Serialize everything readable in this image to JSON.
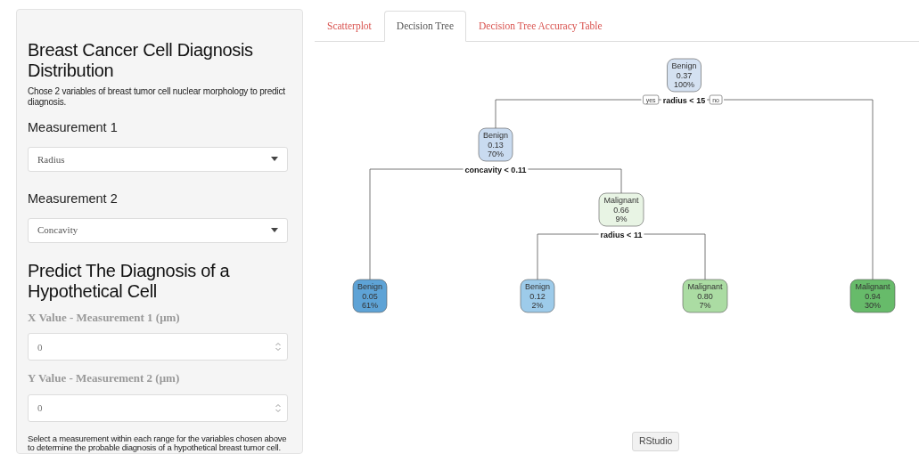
{
  "sidebar": {
    "title": "Breast Cancer Cell Diagnosis Distribution",
    "description": "Chose 2 variables of breast tumor cell nuclear morphology to predict diagnosis.",
    "selects": [
      {
        "label": "Measurement 1",
        "value": "Radius"
      },
      {
        "label": "Measurement 2",
        "value": "Concavity"
      }
    ],
    "predict_title": "Predict The Diagnosis of a Hypothetical Cell",
    "inputs": [
      {
        "label": "X Value - Measurement 1 (μm)",
        "value": "0"
      },
      {
        "label": "Y Value - Measurement 2 (μm)",
        "value": "0"
      }
    ],
    "note": "Select a measurement within each range for the variables chosen above to determine the probable diagnosis of a hypothetical breast tumor cell."
  },
  "tabs": [
    {
      "label": "Scatterplot",
      "selected": false
    },
    {
      "label": "Decision Tree",
      "selected": true
    },
    {
      "label": "Decision Tree Accuracy Table",
      "selected": false
    }
  ],
  "tree": {
    "label": "Benign",
    "prob": "0.37",
    "pct": "100%",
    "color": "#d4e1f1",
    "split": "radius < 15",
    "yes_label": "yes",
    "no_label": "no",
    "children": [
      {
        "label": "Benign",
        "prob": "0.13",
        "pct": "70%",
        "color": "#c9dbf0",
        "split": "concavity < 0.11",
        "children": [
          {
            "label": "Benign",
            "prob": "0.05",
            "pct": "61%",
            "color": "#5ea3d6"
          },
          {
            "label": "Malignant",
            "prob": "0.66",
            "pct": "9%",
            "color": "#e8f4e4",
            "split": "radius < 11",
            "children": [
              {
                "label": "Benign",
                "prob": "0.12",
                "pct": "2%",
                "color": "#9dcbea"
              },
              {
                "label": "Malignant",
                "prob": "0.80",
                "pct": "7%",
                "color": "#abdca3"
              }
            ]
          }
        ]
      },
      {
        "label": "Malignant",
        "prob": "0.94",
        "pct": "30%",
        "color": "#67bb6a"
      }
    ]
  },
  "tooltip": "RStudio"
}
